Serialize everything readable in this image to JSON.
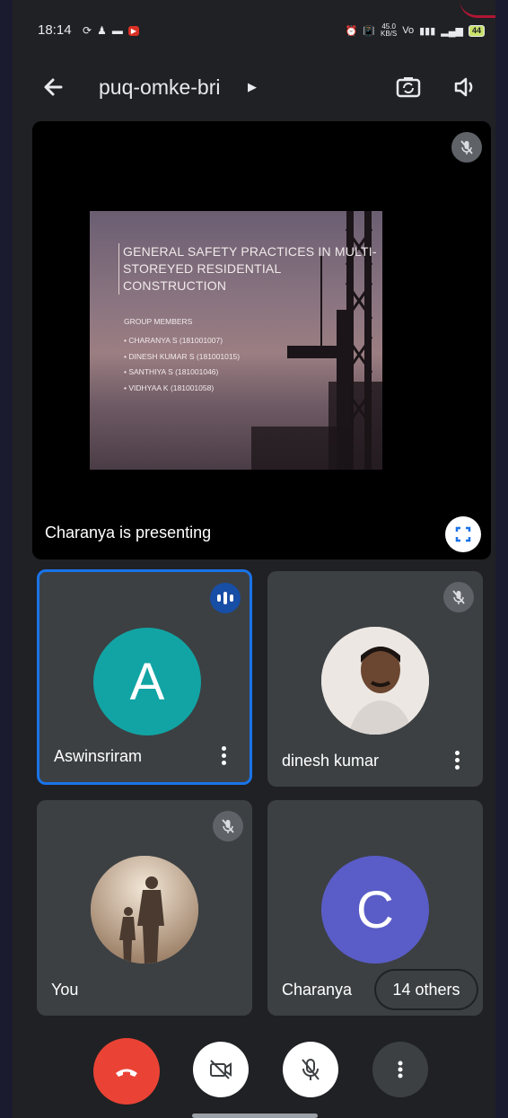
{
  "status_bar": {
    "time": "18:14",
    "net_speed_value": "45.0",
    "net_speed_unit": "KB/S",
    "battery": "44"
  },
  "header": {
    "meeting_code": "puq-omke-bri"
  },
  "presentation": {
    "slide_title": "GENERAL SAFETY PRACTICES IN MULTI-STOREYED RESIDENTIAL CONSTRUCTION",
    "group_label": "GROUP MEMBERS",
    "members": [
      "CHARANYA S (181001007)",
      "DINESH KUMAR S (181001015)",
      "SANTHIYA S (181001046)",
      "VIDHYAA K (181001058)"
    ],
    "presenting_label": "Charanya  is presenting"
  },
  "participants": [
    {
      "name": "Aswinsriram",
      "initial": "A",
      "avatar_color": "#12a4a4",
      "speaking": true
    },
    {
      "name": "dinesh kumar",
      "initial": "",
      "avatar_color": "#e9e6e3",
      "muted": true
    },
    {
      "name": "You",
      "initial": "",
      "avatar_color": "#c9b29a",
      "muted": true
    },
    {
      "name": "Charanya",
      "initial": "C",
      "avatar_color": "#5a5dc7"
    }
  ],
  "others_chip": "14 others",
  "colors": {
    "end_call": "#ea4335",
    "active_border": "#1a73e8",
    "tile_bg": "#3c4043"
  }
}
